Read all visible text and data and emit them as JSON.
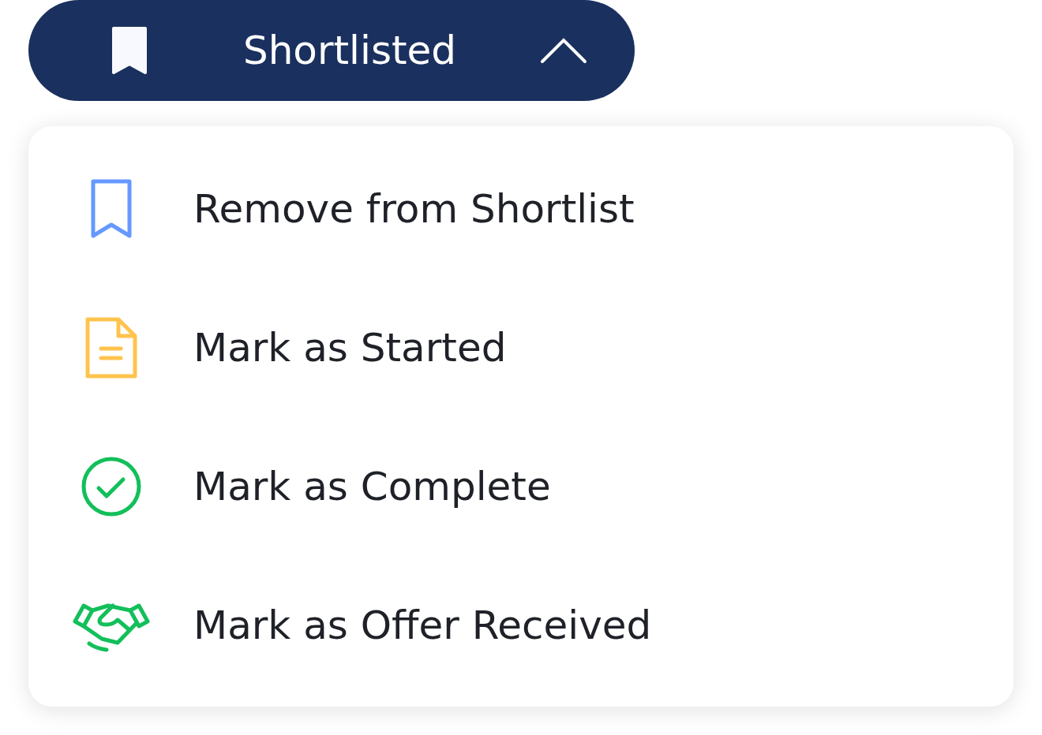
{
  "status_button": {
    "label": "Shortlisted",
    "expanded": true
  },
  "menu": {
    "items": [
      {
        "kind": "bookmark",
        "label": "Remove from Shortlist"
      },
      {
        "kind": "document",
        "label": "Mark as Started"
      },
      {
        "kind": "check",
        "label": "Mark as Complete"
      },
      {
        "kind": "handshake",
        "label": "Mark as Offer Received"
      }
    ]
  }
}
